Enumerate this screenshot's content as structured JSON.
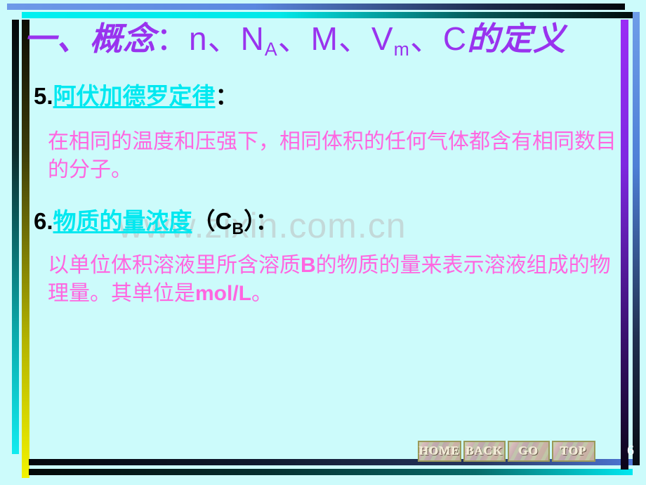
{
  "slide": {
    "background_color": "#ccfbfb",
    "page_number": "6",
    "watermark": "www.zixin.com.cn",
    "title": {
      "prefix_cn": "一、概念",
      "colon": "：",
      "symbols_plain": "n、N",
      "sub_a": "A",
      "symbols_mid": "、M、V",
      "sub_m": "m",
      "symbols_tail": "、C",
      "suffix_cn": "的定义",
      "color": "#9933ee"
    }
  },
  "items": [
    {
      "number": "5.",
      "term": "阿伏加德罗定律",
      "colon": "：",
      "term_color": "#00e8f0",
      "body": "在相同的温度和压强下，相同体积的任何气体都含有相同数目的分子。",
      "body_color": "#ff66e0"
    },
    {
      "number": "6.",
      "term": "物质的量浓度",
      "paren_open": "（",
      "formula_main": "C",
      "formula_sub": "B",
      "paren_close": "）",
      "colon": "：",
      "term_color": "#00e8f0",
      "body_part1": "以单位体积溶液里所含溶质",
      "body_bold1": "B",
      "body_part2": "的物质的量来表示溶液组成的物理量。其单位是",
      "body_bold2": "mol/L",
      "body_part3": "。",
      "body_color": "#ff66e0"
    }
  ],
  "nav": {
    "home_label": "HOME",
    "back_label": "BACK",
    "go_label": "GO",
    "top_label": "TOP"
  }
}
